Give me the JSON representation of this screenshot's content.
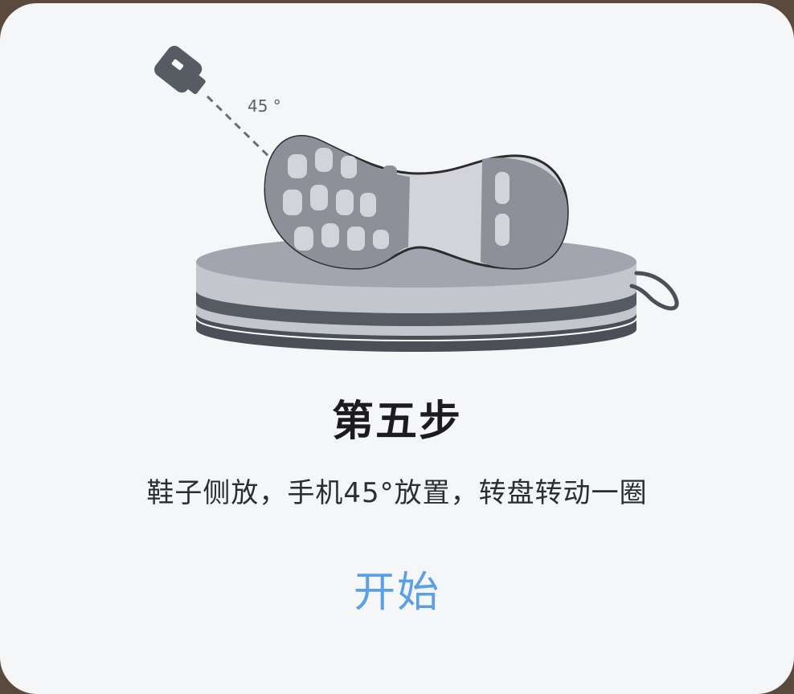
{
  "dialog": {
    "angle_label": "45 °",
    "title": "第五步",
    "description": "鞋子侧放，手机45°放置，转盘转动一圈",
    "start_label": "开始"
  },
  "icons": [
    "phone-icon",
    "shoe-sole-icon",
    "turntable-icon"
  ],
  "colors": {
    "card_background": "#f5f6f7",
    "start_button": "#5b9fe6",
    "title_text": "#1c1c1e"
  }
}
